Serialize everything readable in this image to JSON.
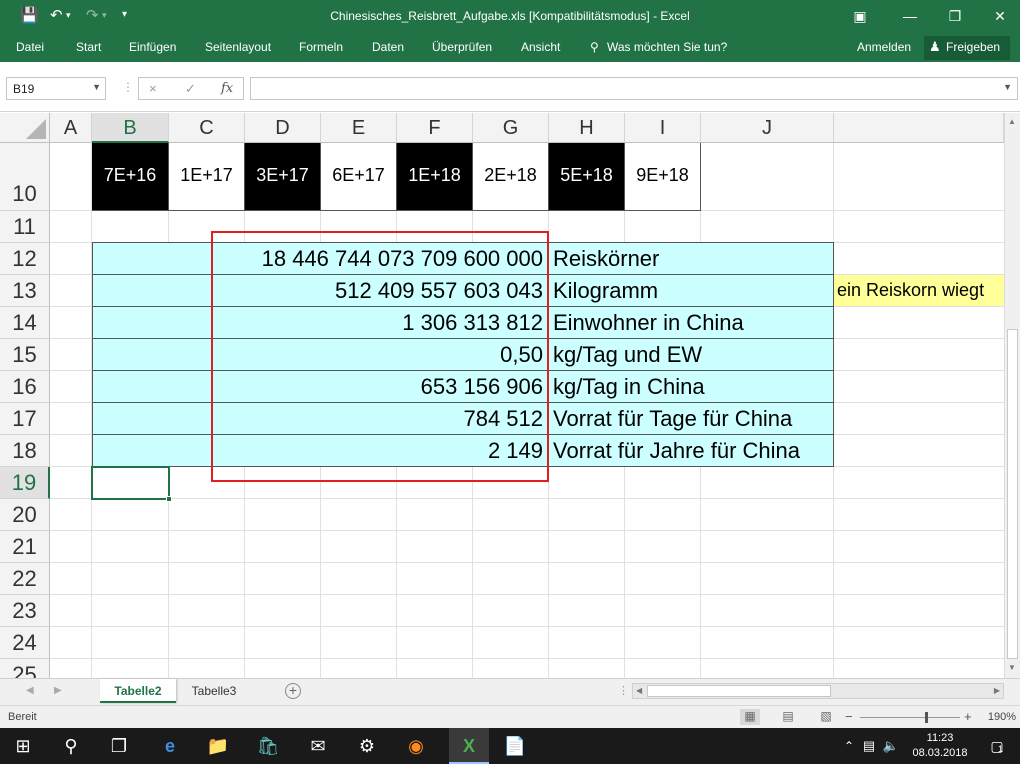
{
  "window": {
    "title": "Chinesisches_Reisbrett_Aufgabe.xls  [Kompatibilitätsmodus] - Excel",
    "colors": {
      "accent": "#217346",
      "cyan_fill": "#ccffff",
      "yellow_fill": "#ffff99",
      "red_outline": "#e02020"
    }
  },
  "ribbon": {
    "tabs": [
      "Datei",
      "Start",
      "Einfügen",
      "Seitenlayout",
      "Formeln",
      "Daten",
      "Überprüfen",
      "Ansicht"
    ],
    "tell_me": "Was möchten Sie tun?",
    "signin": "Anmelden",
    "share": "Freigeben"
  },
  "formula_bar": {
    "name_box": "B19",
    "fx": "fx",
    "cancel_icon": "×",
    "enter_icon": "✓",
    "content": ""
  },
  "columns": [
    "A",
    "B",
    "C",
    "D",
    "E",
    "F",
    "G",
    "H",
    "I",
    "J"
  ],
  "selected_column": "B",
  "rows": [
    "10",
    "11",
    "12",
    "13",
    "14",
    "15",
    "16",
    "17",
    "18",
    "19",
    "20",
    "21",
    "22",
    "23",
    "24",
    "25"
  ],
  "selected_row": "19",
  "row10": [
    {
      "text": "7E+16",
      "dark": true
    },
    {
      "text": "1E+17",
      "dark": false
    },
    {
      "text": "3E+17",
      "dark": true
    },
    {
      "text": "6E+17",
      "dark": false
    },
    {
      "text": "1E+18",
      "dark": true
    },
    {
      "text": "2E+18",
      "dark": false
    },
    {
      "text": "5E+18",
      "dark": true
    },
    {
      "text": "9E+18",
      "dark": false
    }
  ],
  "table": [
    {
      "value": "18 446 744 073 709 600 000",
      "label": "Reiskörner"
    },
    {
      "value": "512 409 557 603 043",
      "label": "Kilogramm"
    },
    {
      "value": "1 306 313 812",
      "label": "Einwohner in China"
    },
    {
      "value": "0,50",
      "label": "kg/Tag und EW"
    },
    {
      "value": "653 156 906",
      "label": "kg/Tag in China"
    },
    {
      "value": "784 512",
      "label": "Vorrat für Tage für China"
    },
    {
      "value": "2 149",
      "label": "Vorrat für Jahre für China"
    }
  ],
  "note": "ein Reiskorn wiegt",
  "sheets": [
    {
      "name": "Tabelle2",
      "active": true
    },
    {
      "name": "Tabelle3",
      "active": false
    }
  ],
  "status": {
    "text": "Bereit",
    "zoom": "190%"
  },
  "taskbar": {
    "time": "11:23",
    "date": "08.03.2018",
    "notifications": "1"
  }
}
